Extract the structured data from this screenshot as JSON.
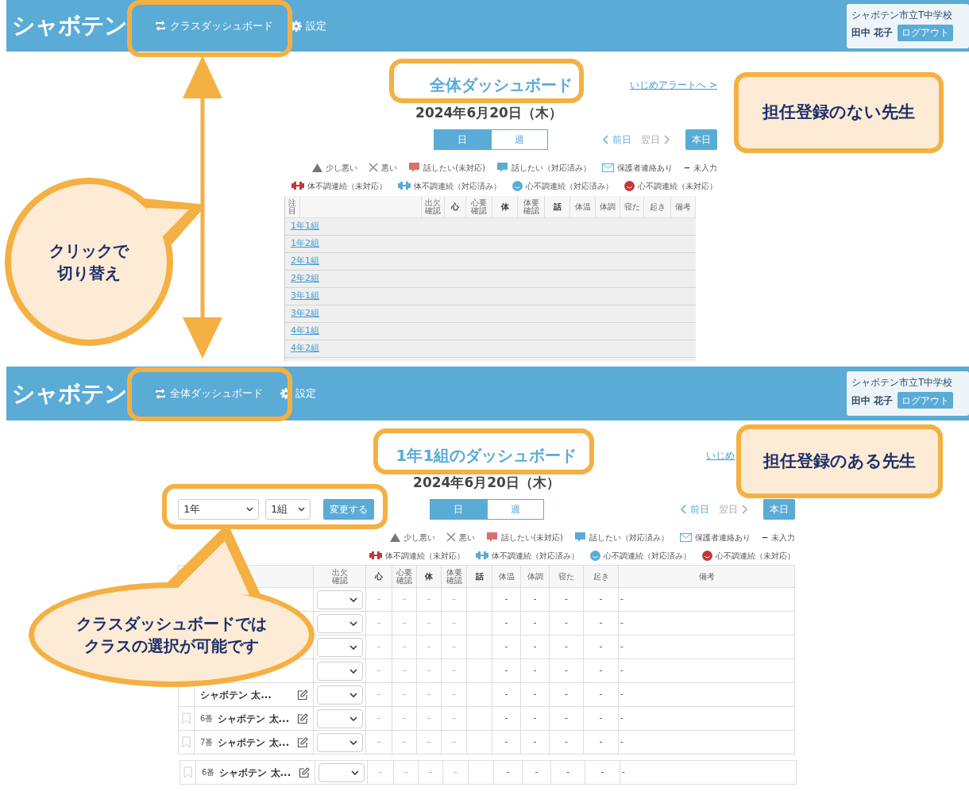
{
  "panels": [
    {
      "header": {
        "logo": "シャボテン",
        "nav": [
          {
            "kind": "switch",
            "label": "クラスダッシュボード"
          },
          {
            "kind": "settings",
            "label": "設定"
          }
        ],
        "school": "シャボテン市立T中学校",
        "user": "田中 花子",
        "logout": "ログアウト"
      },
      "title": "全体ダッシュボード",
      "alert_link": "いじめアラートへ >",
      "date": "2024年6月20日（木）",
      "period_tabs": [
        {
          "label": "日",
          "selected": true
        },
        {
          "label": "週",
          "selected": false
        }
      ],
      "day_nav": {
        "prev": {
          "label": "前日",
          "disabled": false
        },
        "next": {
          "label": "翌日",
          "disabled": true
        },
        "today": "本日"
      },
      "legend": [
        [
          {
            "kind": "triangle",
            "label": "少し悪い"
          },
          {
            "kind": "cross",
            "label": "悪い"
          },
          {
            "kind": "bubble",
            "color": "#d9706d",
            "label": "話したい(未対応)"
          },
          {
            "kind": "bubble",
            "color": "#5aabd6",
            "label": "話したい（対応済み）"
          },
          {
            "kind": "envelope",
            "label": "保護者連絡あり"
          },
          {
            "kind": "symbol",
            "symbol": "–",
            "label": "未入力"
          }
        ],
        [
          {
            "kind": "dumbbell",
            "color": "#c0393b",
            "label": "体不調連続（未対応）"
          },
          {
            "kind": "dumbbell",
            "color": "#5aabd6",
            "label": "体不調連続（対応済み）"
          },
          {
            "kind": "face",
            "color": "#5aabd6",
            "label": "心不調連続（対応済み）"
          },
          {
            "kind": "face",
            "color": "#c0393b",
            "label": "心不調連続（未対応）"
          }
        ]
      ],
      "table": {
        "kind": "overview",
        "columns": [
          {
            "label": "注目",
            "bold": false
          },
          {
            "label": "出欠確認",
            "bold": false
          },
          {
            "label": "心",
            "bold": true
          },
          {
            "label": "心要確認",
            "bold": false
          },
          {
            "label": "体",
            "bold": true
          },
          {
            "label": "体要確認",
            "bold": false
          },
          {
            "label": "話",
            "bold": true
          },
          {
            "label": "体温",
            "bold": false
          },
          {
            "label": "体調",
            "bold": false
          },
          {
            "label": "寝た",
            "bold": false
          },
          {
            "label": "起き",
            "bold": false
          },
          {
            "label": "備考",
            "bold": false
          }
        ],
        "rows": [
          {
            "label": "1年1組"
          },
          {
            "label": "1年2組"
          },
          {
            "label": "2年1組"
          },
          {
            "label": "2年2組"
          },
          {
            "label": "3年1組"
          },
          {
            "label": "3年2組"
          },
          {
            "label": "4年1組"
          },
          {
            "label": "4年2組"
          }
        ]
      }
    },
    {
      "header": {
        "logo": "シャボテン",
        "nav": [
          {
            "kind": "switch",
            "label": "全体ダッシュボード"
          },
          {
            "kind": "settings",
            "label": "設定"
          }
        ],
        "school": "シャボテン市立T中学校",
        "user": "田中 花子",
        "logout": "ログアウト"
      },
      "title": "1年1組のダッシュボード",
      "alert_link": "いじめ",
      "date": "2024年6月20日（木）",
      "class_picker": {
        "grade": "1年",
        "class": "1組",
        "button": "変更する"
      },
      "period_tabs": [
        {
          "label": "日",
          "selected": true
        },
        {
          "label": "週",
          "selected": false
        }
      ],
      "day_nav": {
        "prev": {
          "label": "前日",
          "disabled": false
        },
        "next": {
          "label": "翌日",
          "disabled": true
        },
        "today": "本日"
      },
      "legend": [
        [
          {
            "kind": "triangle",
            "label": "少し悪い"
          },
          {
            "kind": "cross",
            "label": "悪い"
          },
          {
            "kind": "bubble",
            "color": "#d9706d",
            "label": "話したい(未対応)"
          },
          {
            "kind": "bubble",
            "color": "#5aabd6",
            "label": "話したい（対応済み）"
          },
          {
            "kind": "envelope",
            "label": "保護者連絡あり"
          },
          {
            "kind": "symbol",
            "symbol": "–",
            "label": "未入力"
          }
        ],
        [
          {
            "kind": "dumbbell",
            "color": "#c0393b",
            "label": "体不調連続（未対応）"
          },
          {
            "kind": "dumbbell",
            "color": "#5aabd6",
            "label": "体不調連続（対応済み）"
          },
          {
            "kind": "face",
            "color": "#5aabd6",
            "label": "心不調連続（対応済み）"
          },
          {
            "kind": "face",
            "color": "#c0393b",
            "label": "心不調連続（未対応）"
          }
        ]
      ],
      "table": {
        "kind": "class",
        "columns": [
          {
            "label": "出欠確認",
            "bold": false
          },
          {
            "label": "心",
            "bold": true
          },
          {
            "label": "心要確認",
            "bold": false
          },
          {
            "label": "体",
            "bold": true
          },
          {
            "label": "体要確認",
            "bold": false
          },
          {
            "label": "話",
            "bold": true
          },
          {
            "label": "体温",
            "bold": false
          },
          {
            "label": "体調",
            "bold": false
          },
          {
            "label": "寝た",
            "bold": false
          },
          {
            "label": "起き",
            "bold": false
          },
          {
            "label": "備考",
            "bold": false
          }
        ],
        "rows": [
          {
            "cells": [
              null,
              "–",
              "–",
              "–",
              "–",
              null,
              "-",
              "-",
              "-",
              "-",
              "-"
            ]
          },
          {
            "cells": [
              null,
              "–",
              "–",
              "–",
              "–",
              null,
              "-",
              "-",
              "-",
              "-",
              "-"
            ]
          },
          {
            "cells": [
              null,
              "–",
              "–",
              "–",
              "–",
              null,
              "-",
              "-",
              "-",
              "-",
              "-"
            ]
          },
          {
            "cells": [
              null,
              "–",
              "–",
              "–",
              "–",
              null,
              "-",
              "-",
              "-",
              "-",
              "-"
            ]
          },
          {
            "name": "シャボテン 太...",
            "cells": [
              null,
              "–",
              "–",
              "–",
              "–",
              null,
              "-",
              "-",
              "-",
              "-",
              "-"
            ]
          },
          {
            "number": "6番",
            "name": "シャボテン 太...",
            "cells": [
              null,
              "–",
              "–",
              "–",
              "–",
              null,
              "-",
              "-",
              "-",
              "-",
              "-"
            ]
          },
          {
            "number": "7番",
            "name": "シャボテン 太...",
            "cells": [
              null,
              "–",
              "–",
              "–",
              "–",
              null,
              "-",
              "-",
              "-",
              "-",
              "-"
            ]
          }
        ],
        "overlap_rows": [
          {
            "number": "6番",
            "name": "シャボテン 太...",
            "cells": [
              null,
              "–",
              "–",
              "–",
              "–",
              null,
              "-",
              "-",
              "-",
              "-",
              "-"
            ]
          }
        ]
      }
    }
  ],
  "notes": [
    {
      "text": "担任登録のない先生"
    },
    {
      "text": "担任登録のある先生"
    }
  ],
  "callouts": [
    {
      "lines": [
        "クリックで",
        "切り替え"
      ]
    },
    {
      "lines": [
        "クラスダッシュボードでは",
        "クラスの選択が可能です"
      ]
    }
  ]
}
